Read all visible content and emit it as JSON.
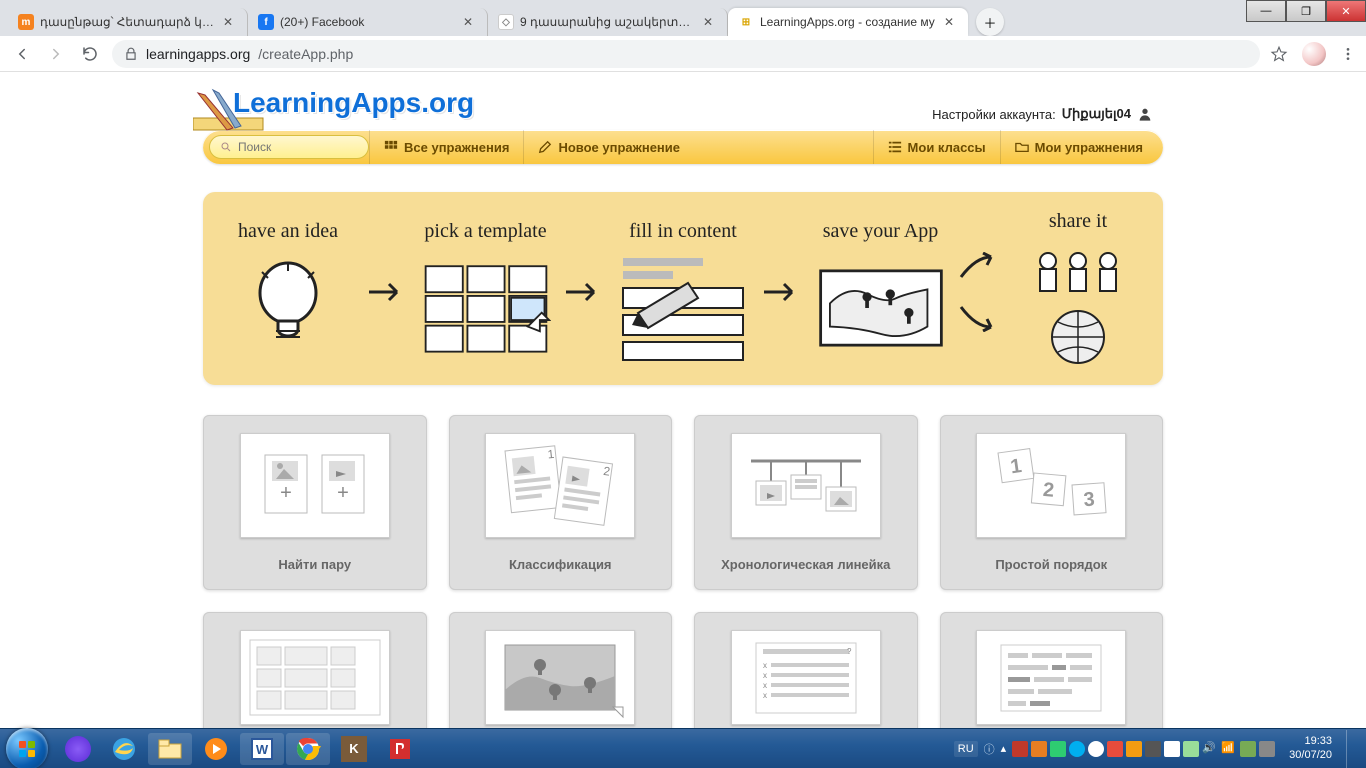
{
  "tabs": [
    {
      "title": "դասընթաց՝ Հետադարձ կապը է",
      "favicon": "m",
      "favicon_bg": "#f5821f",
      "favicon_color": "#fff"
    },
    {
      "title": "(20+) Facebook",
      "favicon": "f",
      "favicon_bg": "#1877f2",
      "favicon_color": "#fff"
    },
    {
      "title": "9 դասարանից աշակերտների ս",
      "favicon": "◇",
      "favicon_bg": "#fff",
      "favicon_color": "#888"
    },
    {
      "title": "LearningApps.org - создание му",
      "favicon": "⊞",
      "favicon_bg": "#fff",
      "favicon_color": "#d9a400"
    }
  ],
  "url": {
    "scheme_icon": "lock",
    "host": "learningapps.org",
    "path": "/createApp.php"
  },
  "site": {
    "logo": "LearningApps.org",
    "account_prefix": "Настройки аккаунта: ",
    "account_user": "Միքայել04",
    "search_placeholder": "Поиск"
  },
  "nav": {
    "all": "Все упражнения",
    "new": "Новое упражнение",
    "classes": "Мои классы",
    "mine": "Мои упражнения"
  },
  "hero_steps": {
    "idea": "have an idea",
    "template": "pick a template",
    "fill": "fill in content",
    "save": "save your App",
    "share": "share it"
  },
  "cards": {
    "pair": "Найти пару",
    "classification": "Классификация",
    "timeline": "Хронологическая линейка",
    "order": "Простой порядок"
  },
  "taskbar": {
    "lang": "RU",
    "time": "19:33",
    "date": "30/07/20"
  }
}
